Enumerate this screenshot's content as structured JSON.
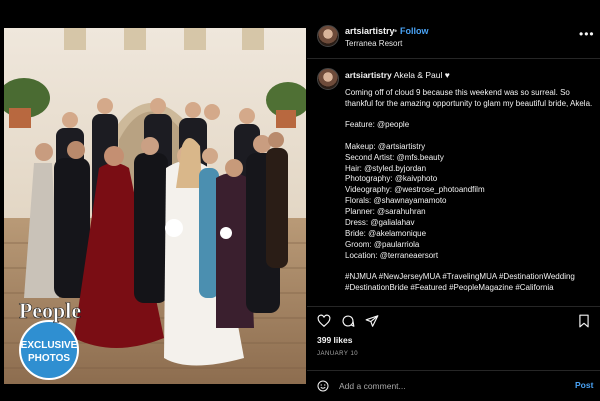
{
  "post": {
    "username": "artsiartistry",
    "follow_label": "Follow",
    "separator": "•",
    "location": "Terranea Resort",
    "more_label": "•••"
  },
  "caption": {
    "username": "artsiartistry",
    "heading": "Akela & Paul ♥",
    "body": [
      "Coming off of cloud 9 because this weekend was so surreal. So thankful for the amazing opportunity to glam my beautiful bride, Akela.",
      "",
      "Feature: @people",
      "",
      "Makeup: @artsiartistry",
      "Second Artist: @mfs.beauty",
      "Hair: @styled.byjordan",
      "Photography: @kaivphoto",
      "Videography: @westrose_photoandfilm",
      "Florals: @shawnayamamoto",
      "Planner: @sarahuhran",
      "Dress: @galialahav",
      "Bride: @akelamonique",
      "Groom: @paularriola",
      "Location: @terraneaersort",
      "",
      "#NJMUA #NewJerseyMUA #TravelingMUA #DestinationWedding #DestinationBride #Featured #PeopleMagazine #California"
    ]
  },
  "stats": {
    "likes": "399 likes",
    "date": "JANUARY 10"
  },
  "comment": {
    "placeholder": "Add a comment...",
    "post_label": "Post"
  },
  "watermark": {
    "brand": "People",
    "line1": "EXCLUSIVE",
    "line2": "PHOTOS"
  },
  "icons": {
    "like": "heart-icon",
    "comment": "comment-icon",
    "share": "share-icon",
    "save": "bookmark-icon",
    "emoji": "emoji-icon"
  },
  "colors": {
    "background": "#000000",
    "link": "#4aa3f5",
    "muted": "#a8a8a8",
    "watermark": "#2f8fd1"
  }
}
